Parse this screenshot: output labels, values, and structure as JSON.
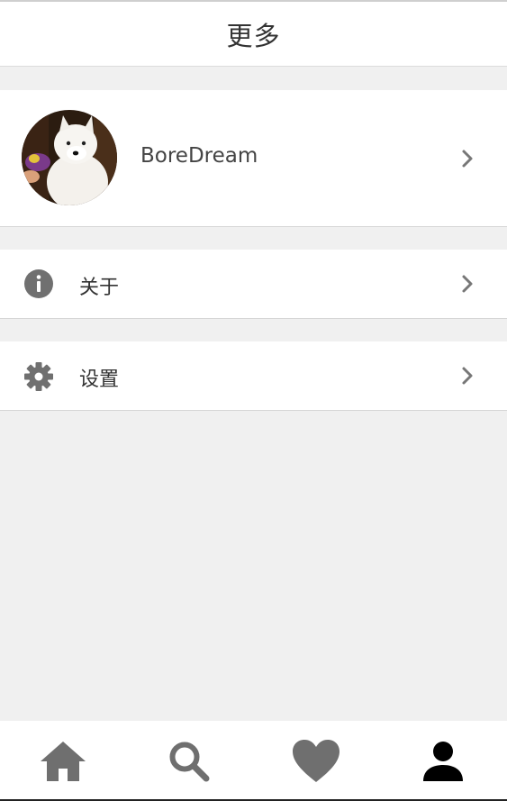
{
  "header": {
    "title": "更多"
  },
  "profile": {
    "username": "BoreDream"
  },
  "menu": {
    "items": [
      {
        "label": "关于",
        "icon": "info-icon"
      },
      {
        "label": "设置",
        "icon": "gear-icon"
      }
    ]
  },
  "bottom_nav": {
    "tabs": [
      {
        "icon": "home-icon",
        "active": false
      },
      {
        "icon": "search-icon",
        "active": false
      },
      {
        "icon": "heart-icon",
        "active": false
      },
      {
        "icon": "person-icon",
        "active": true
      }
    ]
  },
  "colors": {
    "icon_gray": "#6f6f6f",
    "active_icon": "#000000",
    "background": "#f0f0f0"
  }
}
